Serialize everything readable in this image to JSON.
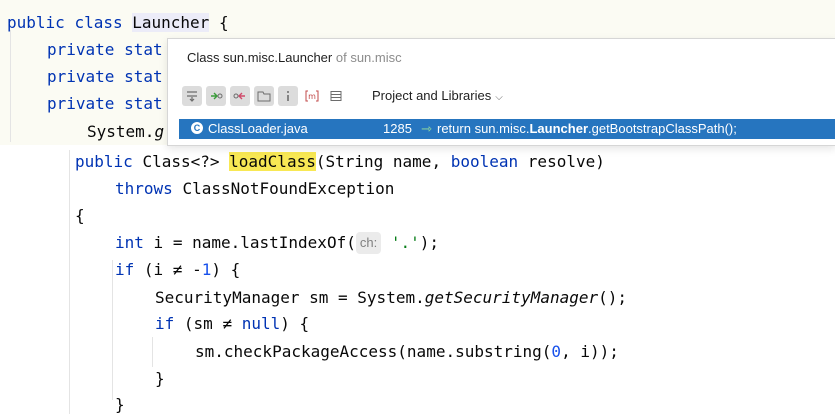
{
  "code": {
    "line1": {
      "kw1": "public",
      "kw2": "class",
      "name": "Launcher",
      "brace": "{"
    },
    "line2": {
      "text": "private stat"
    },
    "line3": {
      "text": "private stat"
    },
    "line4": {
      "text": "private stat"
    },
    "line5": {
      "obj": "System.",
      "rest": "g"
    },
    "line6": {
      "kw": "public",
      "type": "Class<?>",
      "method": "loadClass",
      "open": "(String name,",
      "kw2": "boolean",
      "close": "resolve)"
    },
    "line7": {
      "kw": "throws",
      "text": "ClassNotFoundException"
    },
    "line8": {
      "text": "{"
    },
    "line9": {
      "kw": "int",
      "pre": "i = name.lastIndexOf(",
      "hint": "ch:",
      "str": "'.'",
      "post": ");"
    },
    "line10": {
      "kw": "if",
      "pre": "(i ≠ -",
      "num": "1",
      "post": ") {"
    },
    "line11": {
      "pre": "SecurityManager sm = System.",
      "method": "getSecurityManager",
      "post": "();"
    },
    "line12": {
      "kw": "if",
      "pre": "(sm ≠",
      "kw2": "null",
      "post": ") {"
    },
    "line13": {
      "pre": "sm.checkPackageAccess(name.substring(",
      "num": "0",
      "post": ", i));"
    },
    "line14": {
      "text": "}"
    },
    "line15": {
      "text": "}"
    }
  },
  "popup": {
    "title_main": "Class sun.misc.Launcher",
    "title_of": "of sun.misc",
    "toolbar_icons": [
      "merge-icon",
      "read-access-icon",
      "write-access-icon",
      "folder-icon",
      "info-icon",
      "member-icon",
      "module-icon"
    ],
    "scope_label": "Project and Libraries",
    "result": {
      "file": "ClassLoader.java",
      "line_number": "1285",
      "code_pre": "return sun.misc.",
      "code_bold": "Launcher",
      "code_post": ".getBootstrapClassPath();"
    }
  },
  "colors": {
    "keyword": "#0033b3",
    "selection": "#2675bf",
    "highlight": "#f8e854"
  }
}
